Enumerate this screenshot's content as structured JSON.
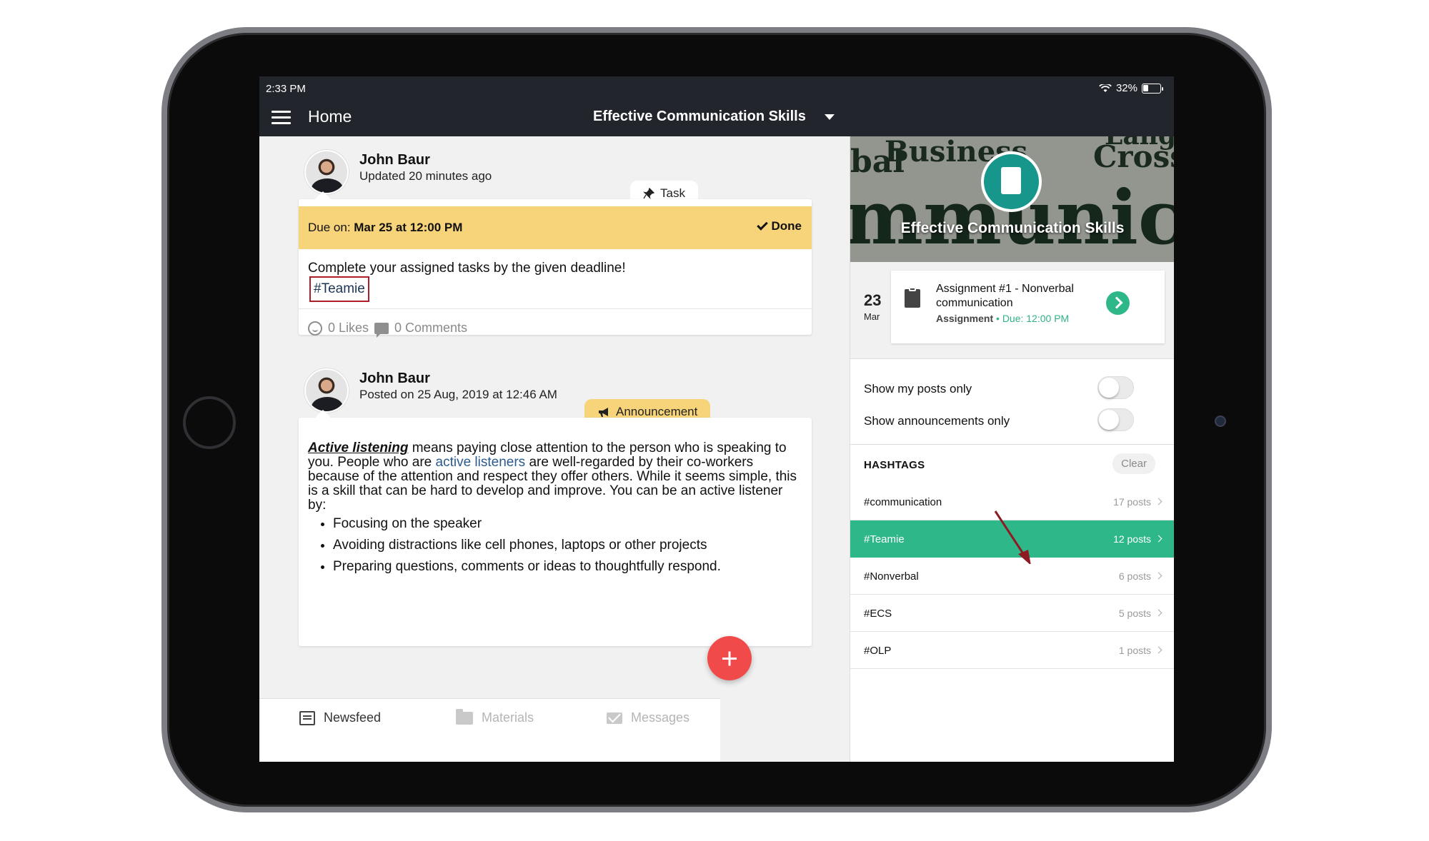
{
  "status": {
    "time": "2:33 PM",
    "battery": "32%"
  },
  "header": {
    "title": "Home",
    "course": "Effective Communication Skills"
  },
  "posts": [
    {
      "author": "John Baur",
      "meta": "Updated 20 minutes ago",
      "tag": "Task",
      "due_prefix": "Due on: ",
      "due_value": "Mar 25 at 12:00 PM",
      "done_label": "Done",
      "text": "Complete your assigned tasks by the given deadline!",
      "hashtag": "#Teamie",
      "likes": "0 Likes",
      "comments": "0 Comments"
    },
    {
      "author": "John Baur",
      "meta": "Posted on 25 Aug, 2019 at 12:46 AM",
      "tag": "Announcement",
      "lead": "Active listening",
      "body1": " means paying close attention to the person who is speaking to you. People who are ",
      "link": "active listeners",
      "body2": " are well-regarded by their co-workers because of the attention and respect they offer others. While it seems simple, this is a skill that can be hard to develop and improve. You can be an active listener by:",
      "bullets": [
        "Focusing on the speaker",
        "Avoiding distractions like cell phones, laptops or other projects",
        "Preparing questions, comments or ideas to thoughtfully respond."
      ]
    }
  ],
  "bottom_nav": {
    "newsfeed": "Newsfeed",
    "materials": "Materials",
    "messages": "Messages"
  },
  "sidebar": {
    "banner_title": "Effective Communication Skills",
    "banner_words": [
      "Business",
      "bal",
      "Cross",
      "Langu",
      "mmunicat"
    ],
    "assignment": {
      "day": "23",
      "month": "Mar",
      "title": "Assignment #1 - Nonverbal communication",
      "type": "Assignment",
      "separator": " • ",
      "due": "Due: 12:00 PM"
    },
    "filters": {
      "my_posts": "Show my posts only",
      "announcements": "Show announcements only"
    },
    "hashtags_label": "HASHTAGS",
    "clear_label": "Clear",
    "hashtags": [
      {
        "name": "#communication",
        "count": "17 posts"
      },
      {
        "name": "#Teamie",
        "count": "12 posts"
      },
      {
        "name": "#Nonverbal",
        "count": "6 posts"
      },
      {
        "name": "#ECS",
        "count": "5 posts"
      },
      {
        "name": "#OLP",
        "count": "1 posts"
      }
    ]
  },
  "colors": {
    "accent": "#2eb88a",
    "appbar": "#22252c",
    "due_banner": "#f7d47a",
    "fab": "#f04a4a",
    "annotation": "#b01c2a"
  }
}
